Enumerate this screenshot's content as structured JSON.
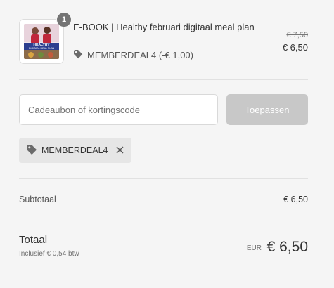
{
  "product": {
    "quantity": "1",
    "title": "E-BOOK | Healthy februari digitaal meal plan",
    "discount_label": "MEMBERDEAL4 (-€ 1,00)",
    "price_original": "€ 7,50",
    "price_current": "€ 6,50",
    "cover_text_top": "HEALTHY",
    "cover_text_bottom": "DIGITAAL MEAL PLAN"
  },
  "discount": {
    "placeholder": "Cadeaubon of kortingscode",
    "apply_label": "Toepassen",
    "applied_code": "MEMBERDEAL4"
  },
  "summary": {
    "subtotal_label": "Subtotaal",
    "subtotal_value": "€ 6,50",
    "total_label": "Totaal",
    "tax_note": "Inclusief € 0,54 btw",
    "currency": "EUR",
    "total_value": "€ 6,50"
  }
}
